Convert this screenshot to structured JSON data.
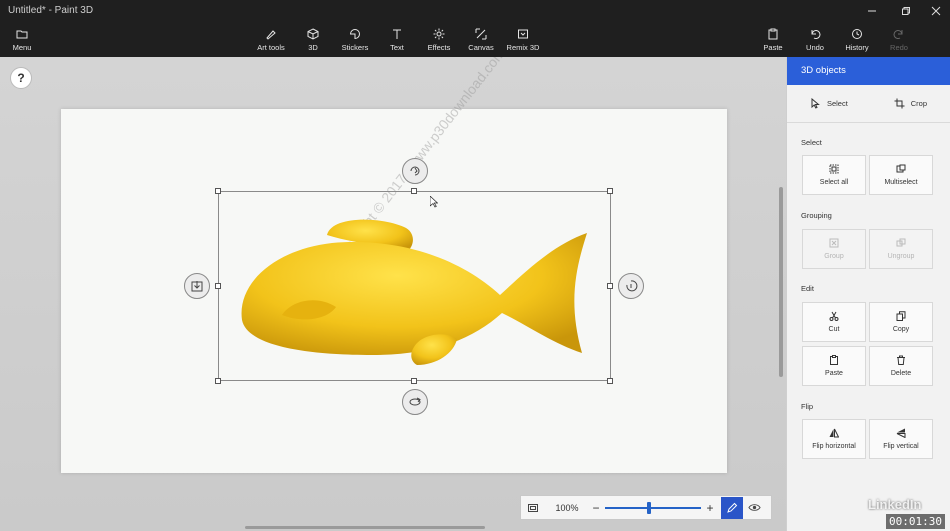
{
  "window": {
    "title": "Untitled* - Paint 3D",
    "minimize_icon": "minimize-icon",
    "restore_icon": "restore-icon",
    "close_icon": "close-icon"
  },
  "toolbar": {
    "menu": {
      "label": "Menu",
      "icon": "folder-icon"
    },
    "tools": [
      {
        "label": "Art tools",
        "icon": "brush-icon"
      },
      {
        "label": "3D",
        "icon": "cube-icon"
      },
      {
        "label": "Stickers",
        "icon": "sticker-icon"
      },
      {
        "label": "Text",
        "icon": "text-icon"
      },
      {
        "label": "Effects",
        "icon": "effects-icon"
      },
      {
        "label": "Canvas",
        "icon": "canvas-icon"
      },
      {
        "label": "Remix 3D",
        "icon": "remix-icon"
      }
    ],
    "actions": [
      {
        "label": "Paste",
        "icon": "paste-icon"
      },
      {
        "label": "Undo",
        "icon": "undo-icon"
      },
      {
        "label": "History",
        "icon": "history-icon"
      },
      {
        "label": "Redo",
        "icon": "redo-icon",
        "disabled": true
      }
    ]
  },
  "canvas": {
    "help_label": "?",
    "watermark": "Copyright © 2017 - www.p30download.com",
    "object_color": "#f2c31a"
  },
  "zoom": {
    "value": "100%",
    "minus": "−",
    "plus": "+",
    "level": 0.46,
    "accent": "#2563c7"
  },
  "panel": {
    "title": "3D objects",
    "accent": "#2b5fd9",
    "modes": [
      {
        "label": "Select",
        "icon": "pointer-icon"
      },
      {
        "label": "Crop",
        "icon": "crop-icon"
      }
    ],
    "sections": {
      "select": {
        "title": "Select",
        "buttons": [
          {
            "label": "Select all",
            "icon": "select-all-icon"
          },
          {
            "label": "Multiselect",
            "icon": "multiselect-icon"
          }
        ]
      },
      "grouping": {
        "title": "Grouping",
        "buttons": [
          {
            "label": "Group",
            "icon": "group-icon",
            "disabled": true
          },
          {
            "label": "Ungroup",
            "icon": "ungroup-icon",
            "disabled": true
          }
        ]
      },
      "edit": {
        "title": "Edit",
        "buttons": [
          {
            "label": "Cut",
            "icon": "scissors-icon"
          },
          {
            "label": "Copy",
            "icon": "copy-icon"
          },
          {
            "label": "Paste",
            "icon": "paste-icon"
          },
          {
            "label": "Delete",
            "icon": "trash-icon"
          }
        ]
      },
      "flip": {
        "title": "Flip",
        "buttons": [
          {
            "label": "Flip horizontal",
            "icon": "flip-horizontal-icon"
          },
          {
            "label": "Flip vertical",
            "icon": "flip-vertical-icon"
          }
        ]
      }
    }
  },
  "overlay": {
    "logo": "LinkedIn",
    "timecode": "00:01:30"
  }
}
